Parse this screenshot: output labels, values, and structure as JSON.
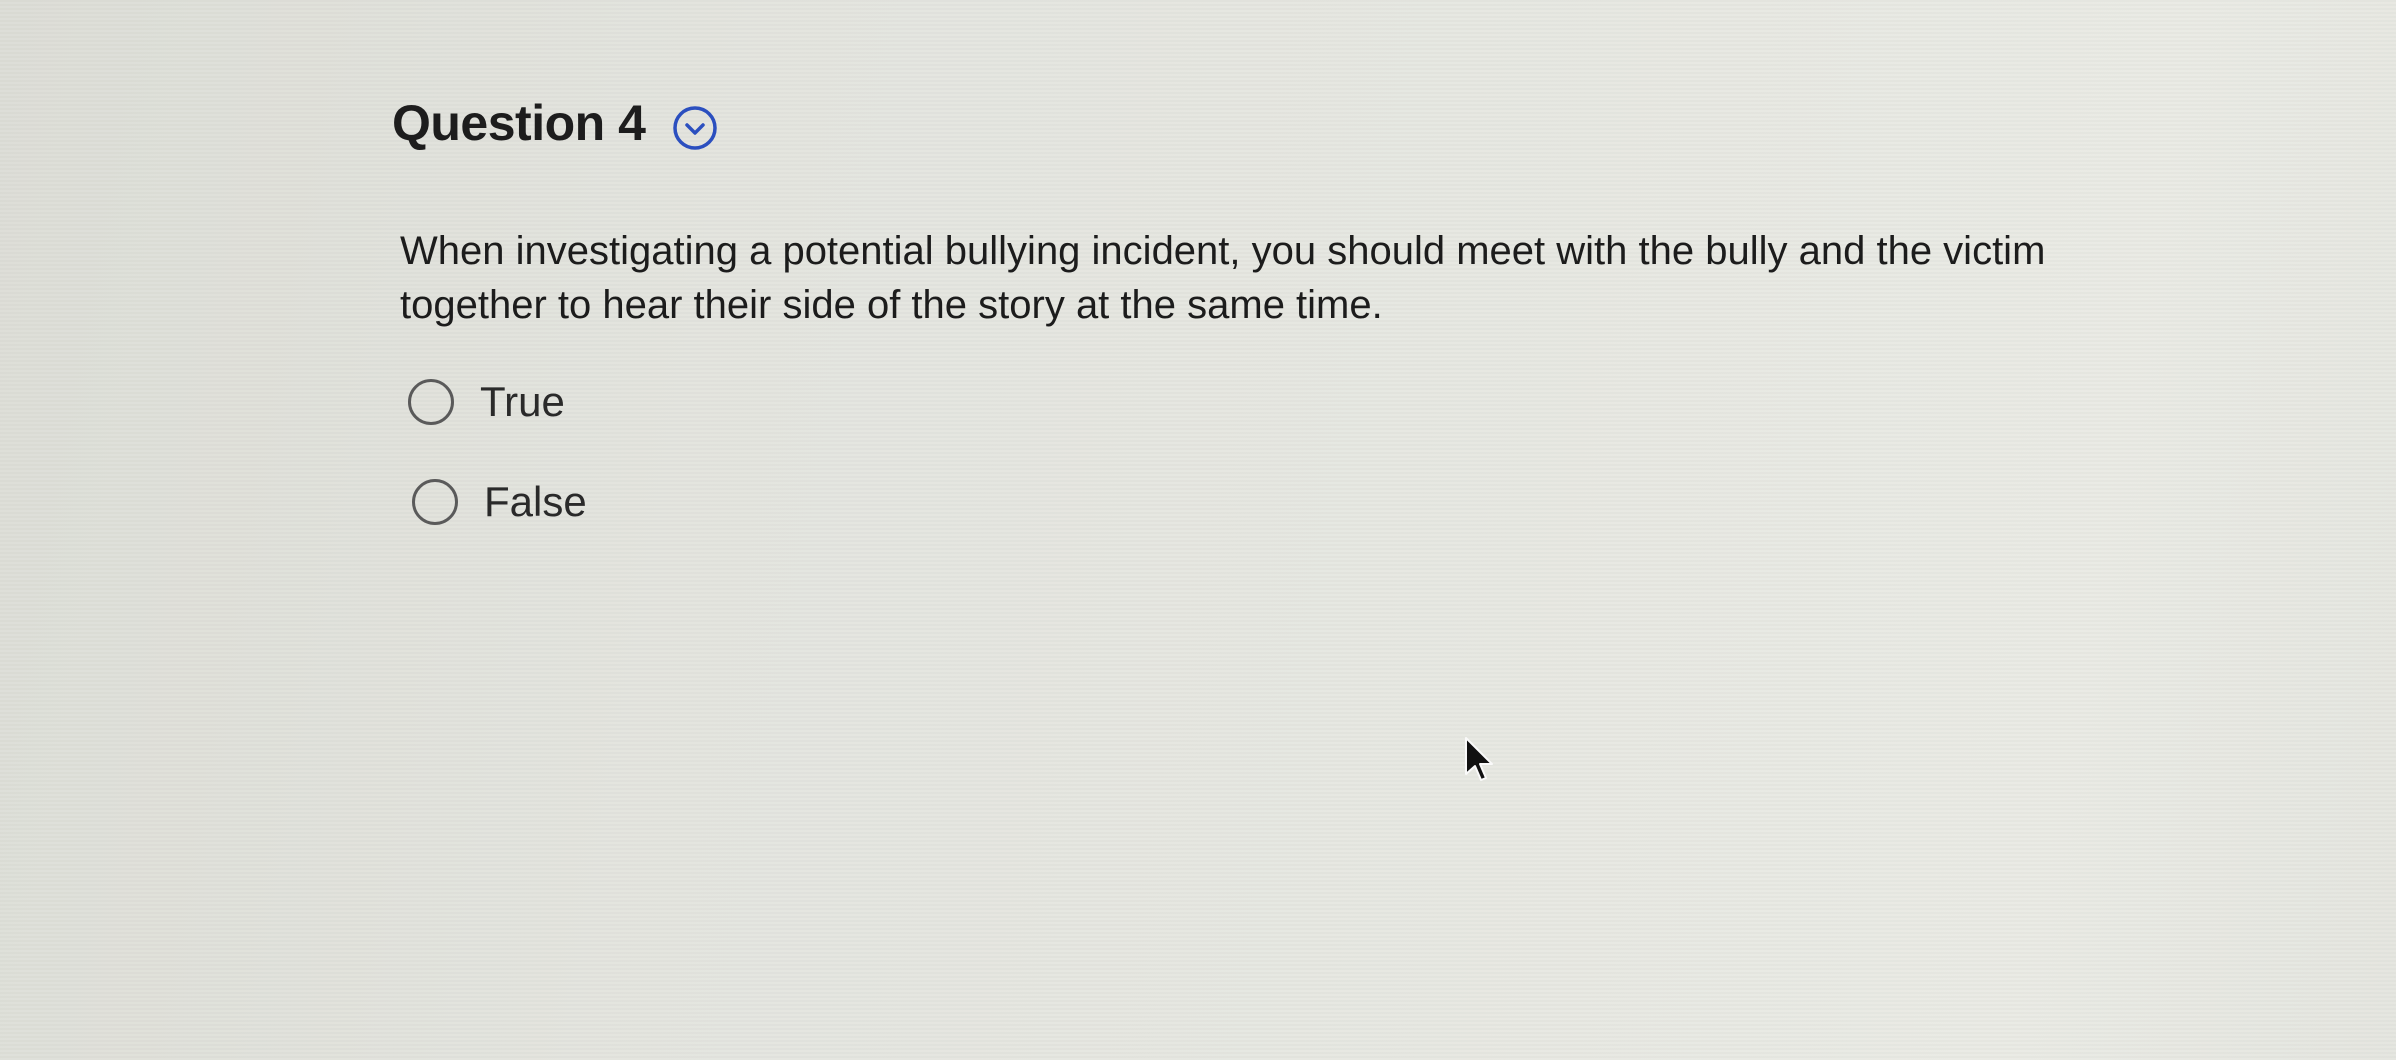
{
  "question": {
    "title": "Question 4",
    "toggle_icon": "chevron-down-circle-icon",
    "text": "When investigating a potential bullying incident, you should meet with the bully and the victim together to hear their side of the story at the same time."
  },
  "options": [
    {
      "label": "True",
      "selected": false
    },
    {
      "label": "False",
      "selected": false
    }
  ],
  "colors": {
    "accent": "#2b4fbf",
    "text": "#1c1c1c",
    "radio_border": "#5a5a5a"
  },
  "cursor_icon": "mouse-pointer-icon"
}
